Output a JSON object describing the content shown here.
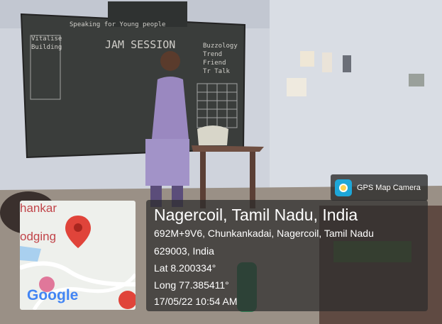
{
  "board": {
    "header": "Speaking for Young people",
    "title": "JAM SESSION",
    "left_words": [
      "Vitalise",
      "Building"
    ],
    "right_words": [
      "Buzzology",
      "Trend",
      "Friend",
      "Tr Talk"
    ]
  },
  "badge": {
    "label": "GPS Map Camera"
  },
  "map": {
    "place_label_1": "hankar",
    "place_label_2": "odging",
    "logo": "Google"
  },
  "location": {
    "title": "Nagercoil, Tamil Nadu, India",
    "address_line1": "692M+9V6, Chunkankadai, Nagercoil, Tamil Nadu",
    "address_line2": "629003, India",
    "lat": "Lat 8.200334°",
    "long": "Long 77.385411°",
    "datetime": "17/05/22 10:54 AM"
  },
  "colors": {
    "pin": "#e0443a",
    "wall": "#d4d7de",
    "board": "#3b3e3d"
  }
}
